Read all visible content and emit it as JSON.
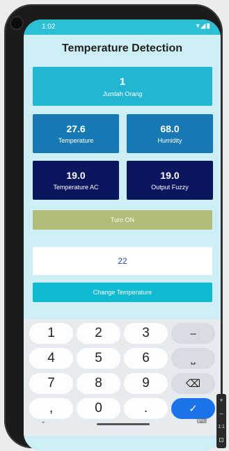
{
  "status": {
    "time": "1:02",
    "icons": "▾◢▮"
  },
  "app": {
    "title": "Temperature Detection"
  },
  "cards": {
    "people": {
      "value": "1",
      "label": "Jumlah Orang",
      "color": "#22b6d3"
    },
    "temperature": {
      "value": "27.6",
      "label": "Temperature",
      "color": "#1679b3"
    },
    "humidity": {
      "value": "68.0",
      "label": "Humidity",
      "color": "#1679b3"
    },
    "temperature_ac": {
      "value": "19.0",
      "label": "Temperature AC",
      "color": "#0b165f"
    },
    "output_fuzzy": {
      "value": "19.0",
      "label": "Output Fuzzy",
      "color": "#0b165f"
    }
  },
  "buttons": {
    "turn_on": "Turn ON",
    "change_temperature": "Change Temperature"
  },
  "input": {
    "value": "22"
  },
  "keyboard": {
    "keys": [
      "1",
      "2",
      "3",
      "–",
      "4",
      "5",
      "6",
      "⎵",
      "7",
      "8",
      "9",
      "⌫",
      ",",
      "0",
      ".",
      "✓"
    ]
  },
  "nav": {
    "back": "⌄",
    "keyboard": "⌨"
  },
  "side_toolbar": {
    "plus": "+",
    "minus": "–",
    "ratio": "1:1",
    "fit": "⊡"
  },
  "colors": {
    "statusbar": "#2bbfd6",
    "background": "#cdeef4",
    "done_key": "#1a73e8"
  }
}
